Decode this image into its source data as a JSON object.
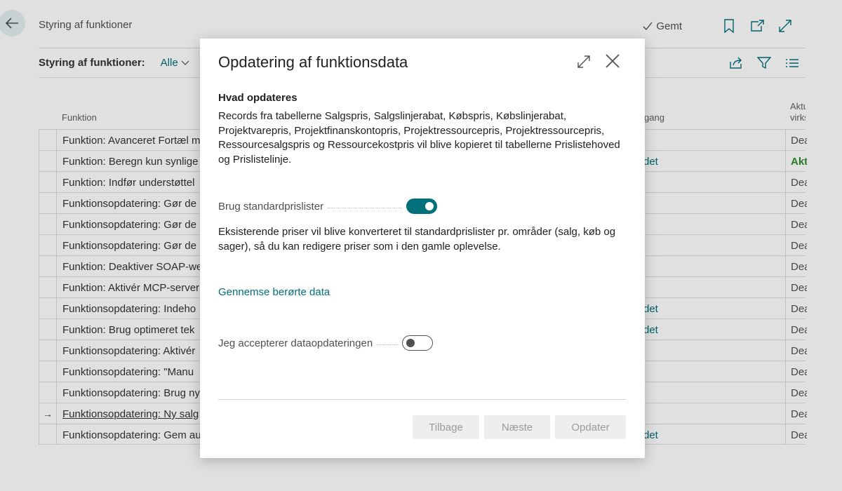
{
  "page": {
    "title": "Styring af funktioner",
    "saved_label": "Gemt",
    "filter_label": "Styring af funktioner:",
    "filter_value": "Alle",
    "columns": {
      "function": "Funktion",
      "access": "gang",
      "enabled_line1": "Aktu",
      "enabled_line2": "virks"
    }
  },
  "rows": [
    {
      "name": "Funktion: Avanceret Fortæl m",
      "mid": "",
      "enabled": "Dea",
      "selector": ""
    },
    {
      "name": "Funktion: Beregn kun synlige",
      "mid": "det",
      "enabled": "Akt",
      "selector": ""
    },
    {
      "name": "Funktion: Indfør understøttel",
      "mid": "",
      "enabled": "Dea",
      "selector": ""
    },
    {
      "name": "Funktionsopdatering: Gør de",
      "mid": "",
      "enabled": "Dea",
      "selector": ""
    },
    {
      "name": "Funktionsopdatering: Gør de",
      "mid": "",
      "enabled": "Dea",
      "selector": ""
    },
    {
      "name": "Funktionsopdatering: Gør de",
      "mid": "",
      "enabled": "Dea",
      "selector": ""
    },
    {
      "name": "Funktion: Deaktiver SOAP-we",
      "mid": "",
      "enabled": "Dea",
      "selector": ""
    },
    {
      "name": "Funktion: Aktivér MCP-server",
      "mid": "",
      "enabled": "Dea",
      "selector": ""
    },
    {
      "name": "Funktionsopdatering: Indeho",
      "mid": "det",
      "enabled": "Dea",
      "selector": ""
    },
    {
      "name": "Funktion: Brug optimeret tek",
      "mid": "det",
      "enabled": "Dea",
      "selector": ""
    },
    {
      "name": "Funktionsopdatering: Aktivér",
      "mid": "",
      "enabled": "Dea",
      "selector": ""
    },
    {
      "name": "Funktionsopdatering: \"Manu",
      "mid": "",
      "enabled": "Dea",
      "selector": ""
    },
    {
      "name": "Funktionsopdatering: Brug ny",
      "mid": "",
      "enabled": "Dea",
      "selector": ""
    },
    {
      "name": "Funktionsopdatering: Ny salg",
      "mid": "",
      "enabled": "Dea",
      "selector": "→"
    },
    {
      "name": "Funktionsopdatering: Gem au",
      "mid": "det",
      "enabled": "Dea",
      "selector": ""
    }
  ],
  "dialog": {
    "title": "Opdatering af funktionsdata",
    "section_heading": "Hvad opdateres",
    "description": "Records fra tabellerne Salgspris, Salgslinjerabat, Købspris, Købslinjerabat, Projektvarepris, Projektfinanskontopris, Projektressourcepris, Projektressourcepris, Ressourcesalgspris og Ressourcekostpris vil blive kopieret til tabellerne Prislistehoved og Prislistelinje.",
    "use_default_price_lists": {
      "label": "Brug standardprislister",
      "value": true
    },
    "note": "Eksisterende priser vil blive konverteret til standardprislister pr. områder (salg, køb og sager), så du kan redigere priser som i den gamle oplevelse.",
    "review_link": "Gennemse berørte data",
    "accept": {
      "label": "Jeg accepterer dataopdateringen",
      "value": false
    },
    "buttons": {
      "back": "Tilbage",
      "next": "Næste",
      "update": "Opdater"
    },
    "accent_color": "#00707a"
  }
}
